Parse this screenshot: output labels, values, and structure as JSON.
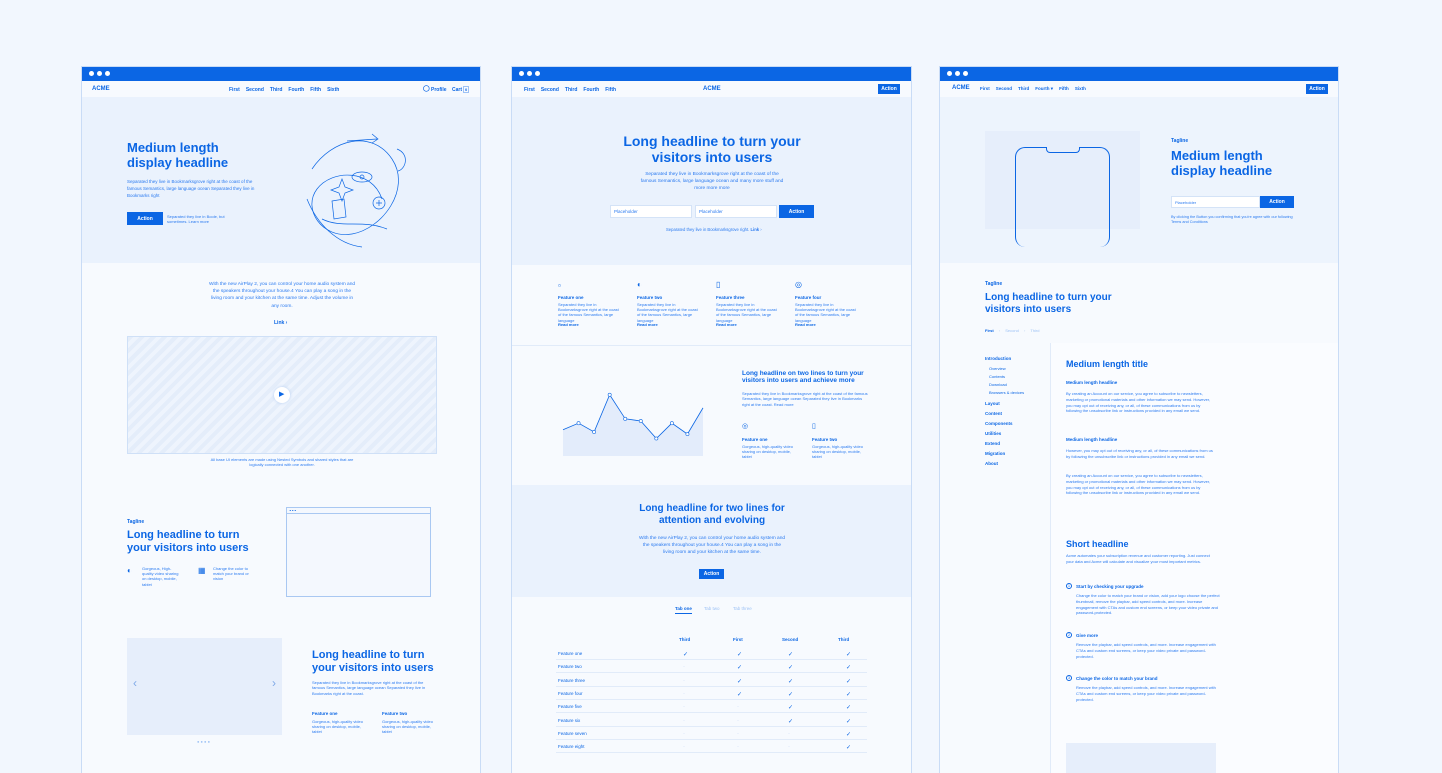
{
  "w1": {
    "logo": "ACME",
    "nav": [
      "First",
      "Second",
      "Third",
      "Fourth",
      "Fifth",
      "Sixth"
    ],
    "profile": "Profile",
    "cart": "Cart",
    "cart_count": "0",
    "hero_h": "Medium length display headline",
    "hero_p": "Separated they live in Bookmarksgrove right at the coast of the famous Semantics, large language ocean Separated they live in Bookmarks right",
    "hero_btn": "Action",
    "hero_note": "Separated they live in Boole, but sometimes. Learn more",
    "intro_p": "With the new AirPlay 2, you can control your home audio system and the speakers throughout your house.4 You can play a song in the living room and your kitchen at the same time. Adjust the volume in any room.",
    "intro_link": "Link",
    "video_caption": "All base UI elements are made using Nested Symbols and shared styles that are logically connected with one another.",
    "tagline": "Tagline",
    "s3_h": "Long headline to turn your visitors into users",
    "f1": "Gorgeous, High-quality video sharing on desktop, mobile, tablet",
    "f2": "Change the color to match your brand or vision",
    "s4_h": "Long headline to turn your visitors into users",
    "s4_p": "Separated they live in Bookmarksgrove right at the coast of the famous Semantics, large language ocean Separated they live in Bookmarks right at the coast.",
    "s4_f1_t": "Feature one",
    "s4_f1_p": "Gorgeous, high-quality video sharing on desktop, mobile, tablet",
    "s4_f2_t": "Feature two",
    "s4_f2_p": "Gorgeous, high-quality video sharing on desktop, mobile, tablet"
  },
  "w2": {
    "logo": "ACME",
    "nav": [
      "First",
      "Second",
      "Third",
      "Fourth",
      "Fifth"
    ],
    "btn": "Action",
    "hero_h": "Long headline to turn your visitors into users",
    "hero_p": "Separated they live in Bookmarksgrove right at the coast of the famous Semantics, large language ocean and many more stuff and more more more",
    "ph1": "Placeholder",
    "ph2": "Placeholder",
    "hero_btn": "Action",
    "hero_link": "Separated they live in Bookmarksgrove right.",
    "hero_link2": "Link",
    "features": [
      {
        "t": "Feature one",
        "p": "Separated they live in Bookmarksgrove right at the coast of the famous Semantics, large language",
        "l": "Read more"
      },
      {
        "t": "Feature two",
        "p": "Separated they live in Bookmarksgrove right at the coast of the famous Semantics, large language",
        "l": "Read more"
      },
      {
        "t": "Feature three",
        "p": "Separated they live in Bookmarksgrove right at the coast of the famous Semantics, large language",
        "l": "Read more"
      },
      {
        "t": "Feature four",
        "p": "Separated they live in Bookmarksgrove right at the coast of the famous Semantics, large language",
        "l": "Read more"
      }
    ],
    "s3_h": "Long headline on two lines to turn your visitors into users and achieve more",
    "s3_p": "Separated they live in Bookmarksgrove right at the coast of the famous Semantics, large language ocean Separated they live in Bookmarks right at the coast. Read more",
    "s3_f1_t": "Feature one",
    "s3_f1_p": "Gorgeous, high-quality video sharing on desktop, mobile, tablet",
    "s3_f2_t": "Feature two",
    "s3_f2_p": "Gorgeous, high-quality video sharing on desktop, mobile, tablet",
    "s4_h": "Long headline for two lines for attention and evolving",
    "s4_p": "With the new AirPlay 2, you can control your home audio system and the speakers throughout your house.4 You can play a song in the living room and your kitchen at the same time.",
    "s4_btn": "Action",
    "tabs": [
      "Tab one",
      "Tab two",
      "Tab three"
    ],
    "cols": [
      "Third",
      "First",
      "Second",
      "Third"
    ],
    "rows": [
      "Feature one",
      "Feature two",
      "Feature three",
      "Feature four",
      "Feature five",
      "Feature six",
      "Feature seven",
      "Feature eight"
    ],
    "checks": [
      [
        1,
        1,
        1,
        1
      ],
      [
        0,
        1,
        1,
        1
      ],
      [
        0,
        1,
        1,
        1
      ],
      [
        0,
        1,
        1,
        1
      ],
      [
        0,
        0,
        1,
        1
      ],
      [
        0,
        0,
        1,
        1
      ],
      [
        0,
        0,
        0,
        1
      ],
      [
        0,
        0,
        0,
        1
      ]
    ]
  },
  "w3": {
    "logo": "ACME",
    "nav": [
      "First",
      "Second",
      "Third",
      "Fourth",
      "Fifth",
      "Sixth"
    ],
    "btn": "Action",
    "tagline": "Tagline",
    "hero_h": "Medium length display headline",
    "ph": "Placeholder",
    "hero_btn": "Action",
    "hero_note": "By clicking the Button you confirming that you're agree with our following Terms and Conditions",
    "s2_tag": "Tagline",
    "s2_h": "Long headline to turn your visitors into users",
    "crumbs": [
      "First",
      "Second",
      "Third"
    ],
    "side": [
      "Introduction",
      "Overview",
      "Contents",
      "Download",
      "Browsers & devices",
      "Layout",
      "Content",
      "Components",
      "Utilities",
      "Extend",
      "Migration",
      "About"
    ],
    "doc_t": "Medium length title",
    "doc_h1": "Medium length headline",
    "doc_p1": "By creating an Account on our service, you agree to subscribe to newsletters, marketing or promotional materials and other information we may send. However, you may opt out of receiving any, or all, of these communications from us by following the unsubscribe link or instructions provided in any email we send.",
    "doc_h2": "Medium length headline",
    "doc_p2": "However, you may opt out of receiving any, or all, of these communications from us by following the unsubscribe link or instructions provided in any email we send.",
    "doc_p3": "By creating an Account on our service, you agree to subscribe to newsletters, marketing or promotional materials and other information we may send. However, you may opt out of receiving any, or all, of these communications from us by following the unsubscribe link or instructions provided in any email we send.",
    "short_h": "Short headline",
    "short_p": "Acme automates your subscription revenue and customer reporting. Just connect your data and Acme will calculate and visualize your most important metrics.",
    "steps": [
      {
        "t": "Start by checking your upgrade",
        "p": "Change the color to match your brand or vision, add your logo choose the perfect thumbnail, remove the playbar, add speed controls, and more. Increase engagement with CTAs and custom end screens, or keep your video private and password-protected."
      },
      {
        "t": "Give more",
        "p": "Remove the playbar, add speed controls, and more. Increase engagement with CTAs and custom end screens, or keep your video private and password-protected."
      },
      {
        "t": "Change the color to match your brand",
        "p": "Remove the playbar, add speed controls, and more. Increase engagement with CTAs and custom end screens, or keep your video private and password-protected."
      }
    ]
  },
  "chart_data": {
    "type": "line",
    "values": [
      42,
      45,
      41,
      58,
      47,
      46,
      38,
      45,
      40,
      52
    ]
  }
}
